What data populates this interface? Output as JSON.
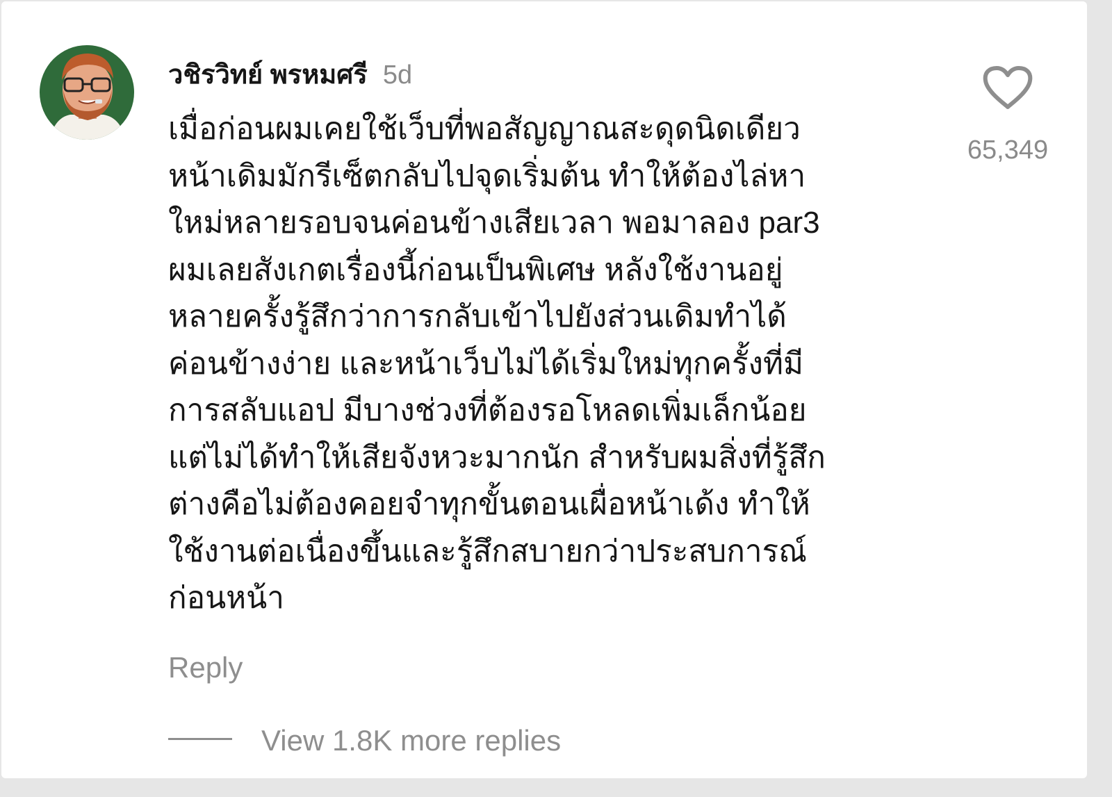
{
  "comment": {
    "author": "วชิรวิทย์ พรหมศรี",
    "timestamp": "5d",
    "lines": [
      "เมื่อก่อนผมเคยใช้เว็บที่พอสัญญาณสะดุดนิดเดียว",
      "หน้าเดิมมักรีเซ็ตกลับไปจุดเริ่มต้น ทำให้ต้องไล่หา",
      "ใหม่หลายรอบจนค่อนข้างเสียเวลา พอมาลอง par3",
      "ผมเลยสังเกตเรื่องนี้ก่อนเป็นพิเศษ หลังใช้งานอยู่",
      "หลายครั้งรู้สึกว่าการกลับเข้าไปยังส่วนเดิมทำได้",
      "ค่อนข้างง่าย และหน้าเว็บไม่ได้เริ่มใหม่ทุกครั้งที่มี",
      "การสลับแอป มีบางช่วงที่ต้องรอโหลดเพิ่มเล็กน้อย",
      "แต่ไม่ได้ทำให้เสียจังหวะมากนัก สำหรับผมสิ่งที่รู้สึก",
      "ต่างคือไม่ต้องคอยจำทุกขั้นตอนเผื่อหน้าเด้ง ทำให้",
      "ใช้งานต่อเนื่องขึ้นและรู้สึกสบายกว่าประสบการณ์",
      "ก่อนหน้า"
    ],
    "like_count": "65,349",
    "like_icon": "heart-outline-icon",
    "reply_label": "Reply",
    "view_replies_label": "View 1.8K more replies"
  },
  "colors": {
    "text_primary": "#161616",
    "text_secondary": "#8e8e8e",
    "card_background": "#ffffff",
    "page_background": "#e6e6e6",
    "avatar_background": "#2f6b3a"
  }
}
